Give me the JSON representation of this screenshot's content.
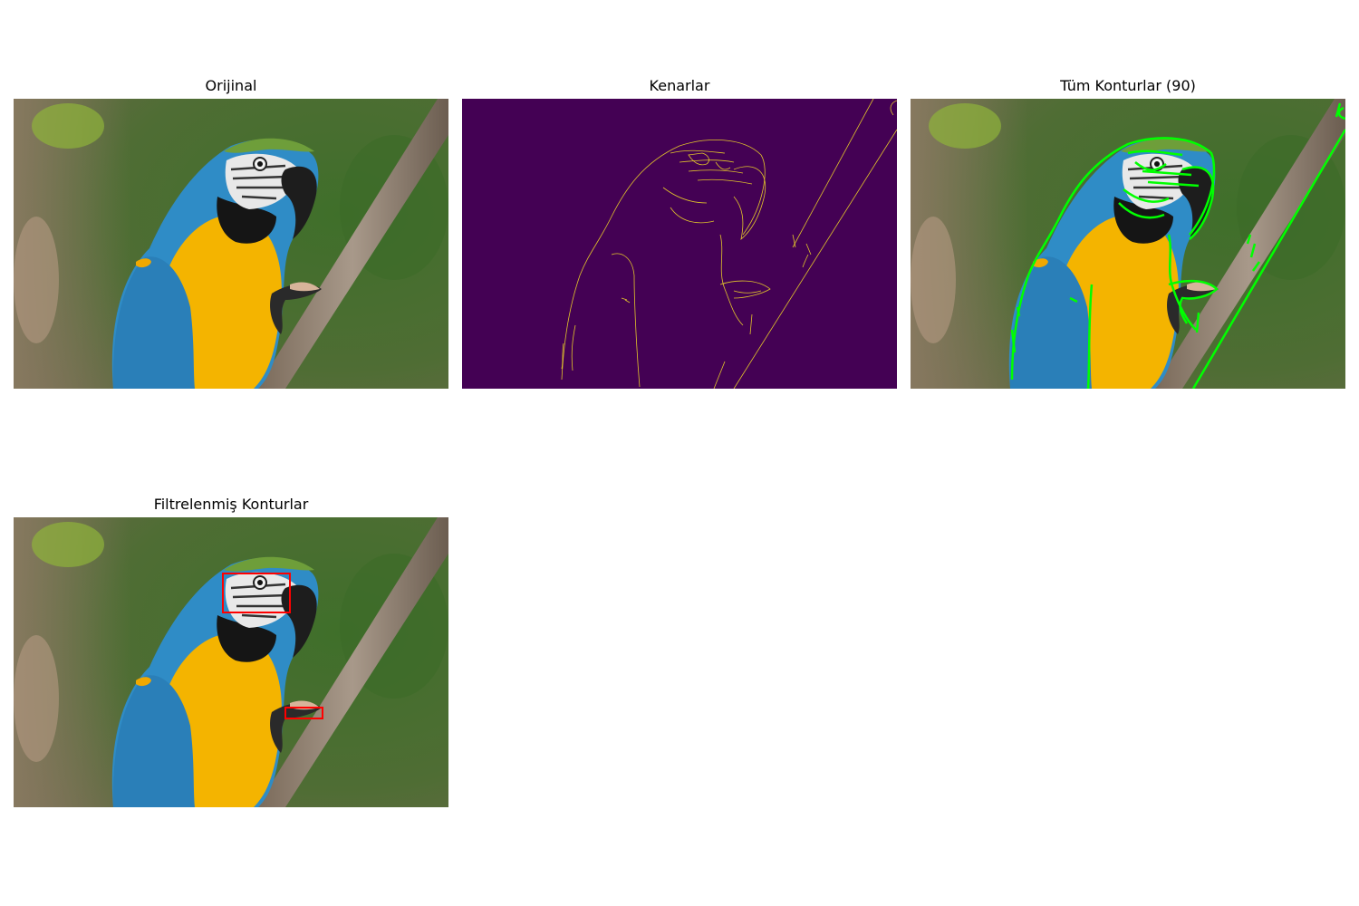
{
  "figure": {
    "panels": [
      {
        "id": "original",
        "title": "Orijinal"
      },
      {
        "id": "edges",
        "title": "Kenarlar"
      },
      {
        "id": "all_contours",
        "title": "Tüm Konturlar (90)"
      },
      {
        "id": "filtered_contours",
        "title": "Filtrelenmiş Konturlar"
      }
    ]
  },
  "colors": {
    "edge_background": "#440154",
    "edge_lines": "#fde725",
    "contour_lines": "#00ff00",
    "bounding_boxes": "#ff0000"
  }
}
